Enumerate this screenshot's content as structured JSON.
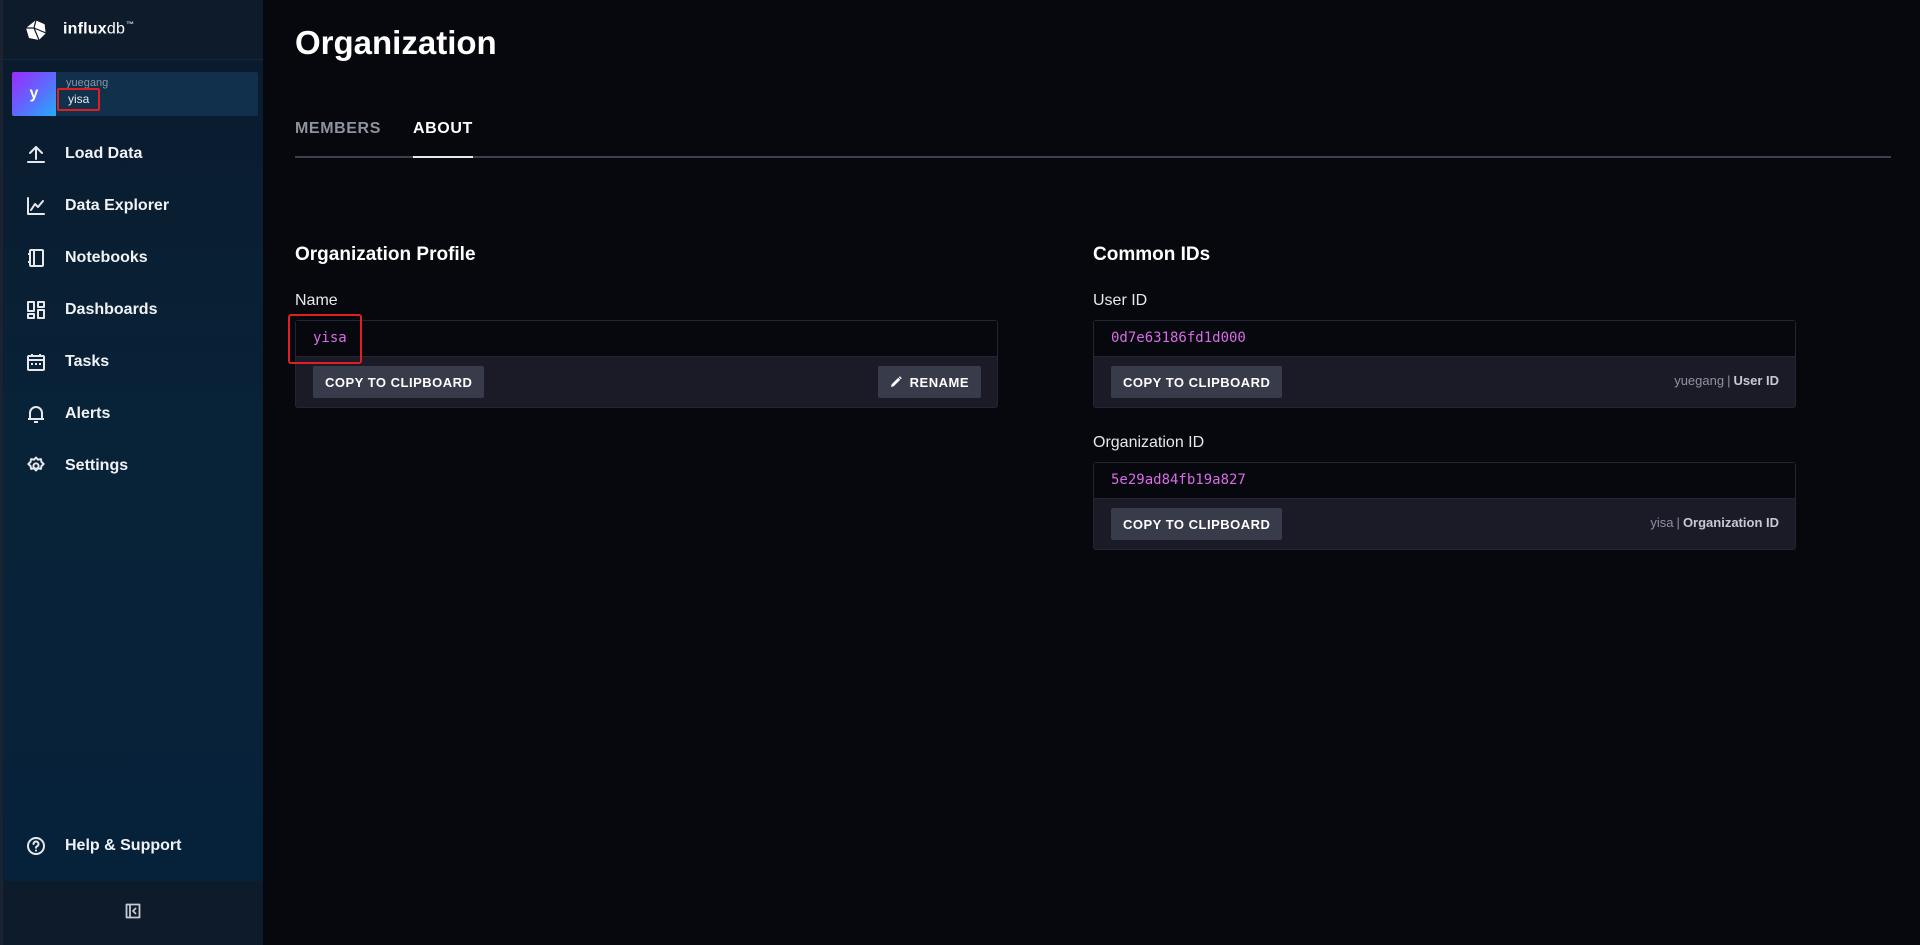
{
  "brand": {
    "name_bold": "influx",
    "name_light": "db",
    "trademark": "™"
  },
  "org_switcher": {
    "avatar_letter": "y",
    "user": "yuegang",
    "org": "yisa"
  },
  "nav": {
    "items": [
      {
        "label": "Load Data",
        "icon": "upload-icon"
      },
      {
        "label": "Data Explorer",
        "icon": "graph-icon"
      },
      {
        "label": "Notebooks",
        "icon": "notebook-icon"
      },
      {
        "label": "Dashboards",
        "icon": "dashboard-icon"
      },
      {
        "label": "Tasks",
        "icon": "calendar-icon"
      },
      {
        "label": "Alerts",
        "icon": "bell-icon"
      },
      {
        "label": "Settings",
        "icon": "gear-icon"
      }
    ],
    "help": {
      "label": "Help & Support",
      "icon": "question-icon"
    },
    "collapse_icon": "collapse-sidebar-icon"
  },
  "page": {
    "title": "Organization"
  },
  "tabs": [
    {
      "label": "MEMBERS",
      "active": false
    },
    {
      "label": "ABOUT",
      "active": true
    }
  ],
  "profile": {
    "section_title": "Organization Profile",
    "name_label": "Name",
    "name_value": "yisa",
    "copy_label": "COPY TO CLIPBOARD",
    "rename_label": "RENAME"
  },
  "common_ids": {
    "section_title": "Common IDs",
    "user_id": {
      "label": "User ID",
      "value": "0d7e63186fd1d000",
      "copy_label": "COPY TO CLIPBOARD",
      "caption_name": "yuegang",
      "caption_type": "User ID"
    },
    "org_id": {
      "label": "Organization ID",
      "value": "5e29ad84fb19a827",
      "copy_label": "COPY TO CLIPBOARD",
      "caption_name": "yisa",
      "caption_type": "Organization ID"
    }
  },
  "colors": {
    "accent_magenta": "#d86ce8",
    "highlight_red": "#e02020",
    "background": "#07080d"
  }
}
